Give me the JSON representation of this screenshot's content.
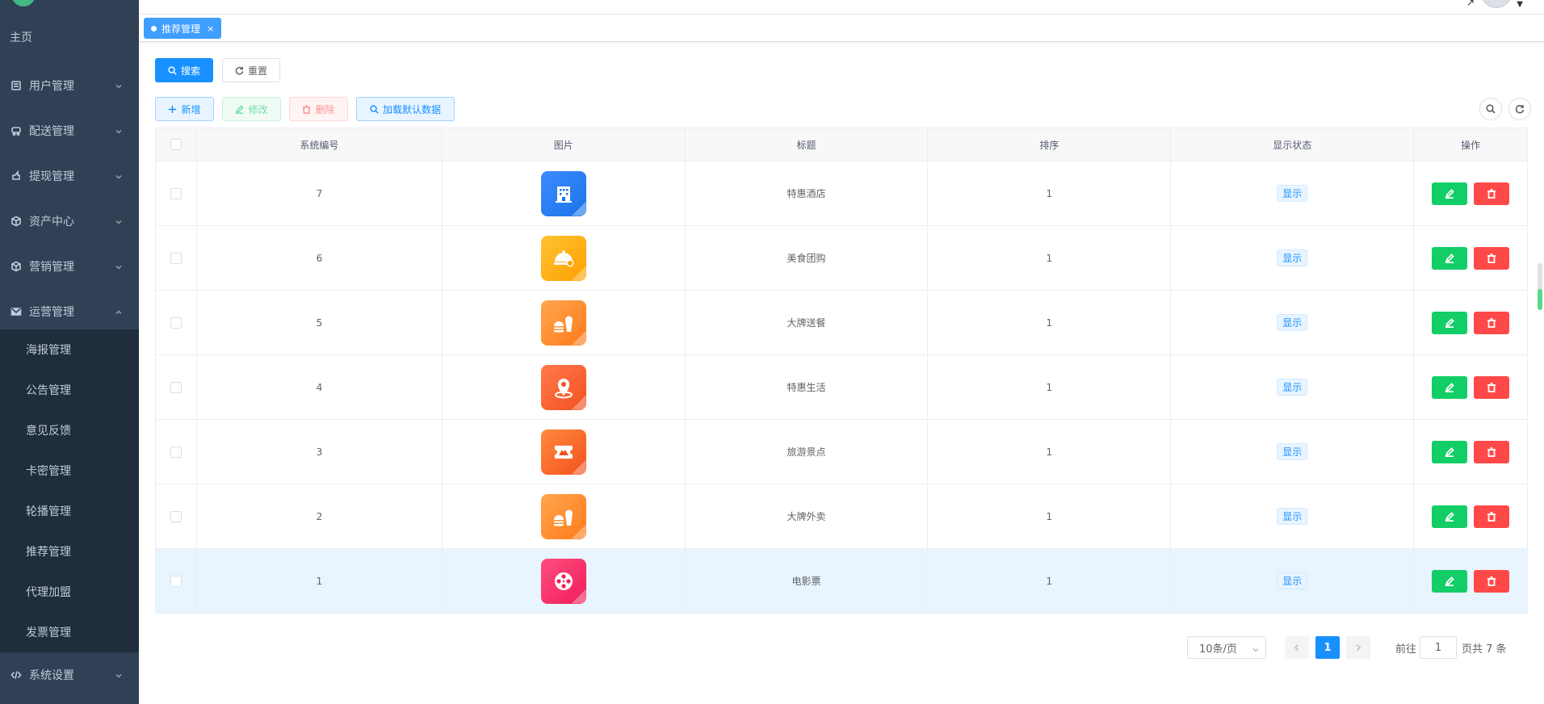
{
  "sidebar": {
    "home": "主页",
    "menus": [
      {
        "label": "用户管理",
        "icon": "user-list-icon",
        "expanded": false
      },
      {
        "label": "配送管理",
        "icon": "delivery-icon",
        "expanded": false
      },
      {
        "label": "提现管理",
        "icon": "withdraw-icon",
        "expanded": false
      },
      {
        "label": "资产中心",
        "icon": "cube-icon",
        "expanded": false
      },
      {
        "label": "营销管理",
        "icon": "cube-icon",
        "expanded": false
      },
      {
        "label": "运营管理",
        "icon": "mail-icon",
        "expanded": true
      },
      {
        "label": "系统设置",
        "icon": "code-icon",
        "expanded": false
      }
    ],
    "submenu": [
      "海报管理",
      "公告管理",
      "意见反馈",
      "卡密管理",
      "轮播管理",
      "推荐管理",
      "代理加盟",
      "发票管理"
    ]
  },
  "tags": [
    {
      "label": "推荐管理",
      "close": "×",
      "active": true
    }
  ],
  "search": {
    "search_label": "搜索",
    "reset_label": "重置"
  },
  "toolbar": {
    "add_label": "新增",
    "edit_label": "修改",
    "delete_label": "删除",
    "load_label": "加载默认数据"
  },
  "table": {
    "headers": [
      "系统编号",
      "图片",
      "标题",
      "排序",
      "显示状态",
      "操作"
    ],
    "rows": [
      {
        "id": "7",
        "title": "特惠酒店",
        "sort": "1",
        "status": "显示",
        "icon": "hotel-icon",
        "color": "#1a73e8",
        "color2": "#3d8bff"
      },
      {
        "id": "6",
        "title": "美食团购",
        "sort": "1",
        "status": "显示",
        "icon": "food-cloche-icon",
        "color": "#ffa000",
        "color2": "#ffc233"
      },
      {
        "id": "5",
        "title": "大牌送餐",
        "sort": "1",
        "status": "显示",
        "icon": "burger-drink-icon",
        "color": "#ff7a1a",
        "color2": "#ffa64d"
      },
      {
        "id": "4",
        "title": "特惠生活",
        "sort": "1",
        "status": "显示",
        "icon": "location-pin-icon",
        "color": "#f4511e",
        "color2": "#ff7a4d"
      },
      {
        "id": "3",
        "title": "旅游景点",
        "sort": "1",
        "status": "显示",
        "icon": "ticket-icon",
        "color": "#f4511e",
        "color2": "#ff8a3d"
      },
      {
        "id": "2",
        "title": "大牌外卖",
        "sort": "1",
        "status": "显示",
        "icon": "burger-drink-icon",
        "color": "#ff7a1a",
        "color2": "#ffa64d"
      },
      {
        "id": "1",
        "title": "电影票",
        "sort": "1",
        "status": "显示",
        "icon": "film-reel-icon",
        "color": "#f01e5a",
        "color2": "#ff4d7e"
      }
    ],
    "highlighted_row": 6
  },
  "pagination": {
    "page_size": "10条/页",
    "current_page": "1",
    "goto_label": "前往",
    "goto_value": "1",
    "total_label": "页共 7 条"
  }
}
